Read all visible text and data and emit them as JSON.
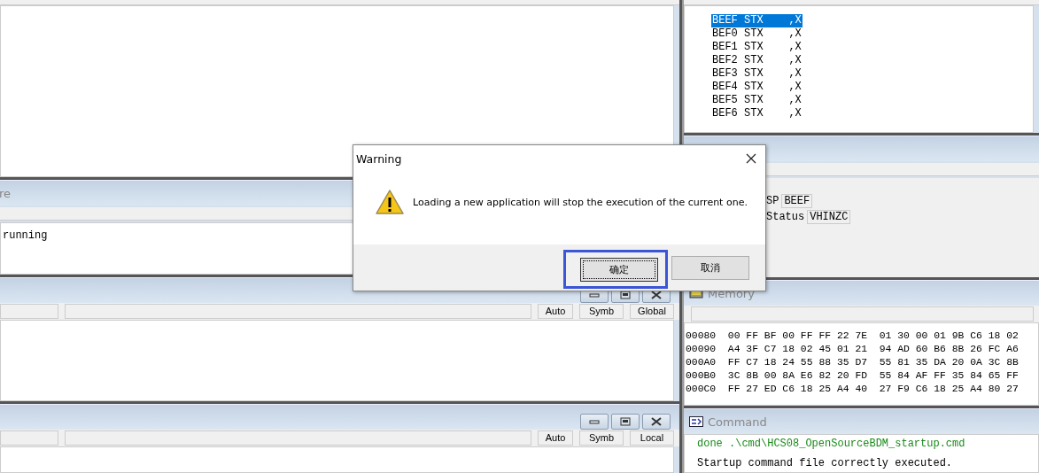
{
  "procedure_pane": {
    "title": "re",
    "lines": [
      "running"
    ]
  },
  "data_panes": [
    {
      "toolbar": [
        "Auto",
        "Symb",
        "Global"
      ]
    },
    {
      "toolbar": [
        "Auto",
        "Symb",
        "Local"
      ]
    }
  ],
  "assembly": {
    "rows": [
      {
        "address": "BEEF",
        "mnemonic": "STX",
        "operand": ",X",
        "selected": true
      },
      {
        "address": "BEF0",
        "mnemonic": "STX",
        "operand": ",X",
        "selected": false
      },
      {
        "address": "BEF1",
        "mnemonic": "STX",
        "operand": ",X",
        "selected": false
      },
      {
        "address": "BEF2",
        "mnemonic": "STX",
        "operand": ",X",
        "selected": false
      },
      {
        "address": "BEF3",
        "mnemonic": "STX",
        "operand": ",X",
        "selected": false
      },
      {
        "address": "BEF4",
        "mnemonic": "STX",
        "operand": ",X",
        "selected": false
      },
      {
        "address": "BEF5",
        "mnemonic": "STX",
        "operand": ",X",
        "selected": false
      },
      {
        "address": "BEF6",
        "mnemonic": "STX",
        "operand": ",X",
        "selected": false
      }
    ]
  },
  "registers": [
    {
      "name": "SP",
      "value": "BEEF"
    },
    {
      "name": "Status",
      "value": "VHINZC"
    }
  ],
  "memory": {
    "title": "Memory",
    "rows": [
      {
        "address": "00080",
        "bytes": [
          "00",
          "FF",
          "BF",
          "00",
          "FF",
          "FF",
          "22",
          "7E",
          "01",
          "30",
          "00",
          "01",
          "9B",
          "C6",
          "18",
          "02"
        ]
      },
      {
        "address": "00090",
        "bytes": [
          "A4",
          "3F",
          "C7",
          "18",
          "02",
          "45",
          "01",
          "21",
          "94",
          "AD",
          "60",
          "B6",
          "8B",
          "26",
          "FC",
          "A6"
        ]
      },
      {
        "address": "000A0",
        "bytes": [
          "FF",
          "C7",
          "18",
          "24",
          "55",
          "88",
          "35",
          "D7",
          "55",
          "81",
          "35",
          "DA",
          "20",
          "0A",
          "3C",
          "8B"
        ]
      },
      {
        "address": "000B0",
        "bytes": [
          "3C",
          "8B",
          "00",
          "8A",
          "E6",
          "82",
          "20",
          "FD",
          "55",
          "84",
          "AF",
          "FF",
          "35",
          "84",
          "65",
          "FF"
        ]
      },
      {
        "address": "000C0",
        "bytes": [
          "FF",
          "27",
          "ED",
          "C6",
          "18",
          "25",
          "A4",
          "40",
          "27",
          "F9",
          "C6",
          "18",
          "25",
          "A4",
          "80",
          "27"
        ]
      }
    ]
  },
  "command": {
    "title": "Command",
    "lines": [
      {
        "text": "done .\\cmd\\HCS08_OpenSourceBDM_startup.cmd",
        "kind": "info"
      },
      {
        "text": "Startup command file correctly executed.",
        "kind": "normal"
      }
    ]
  },
  "dialog": {
    "title": "Warning",
    "message": "Loading a new application will stop the execution of the current one.",
    "buttons": [
      {
        "label": "确定",
        "focused": true
      },
      {
        "label": "取消",
        "focused": false
      }
    ]
  }
}
